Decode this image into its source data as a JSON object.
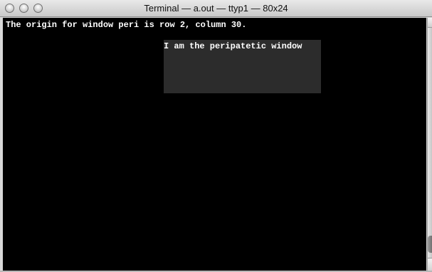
{
  "window": {
    "title": "Terminal — a.out — ttyp1 — 80x24"
  },
  "terminal": {
    "lines": [
      "The origin for window peri is row 2, column 30."
    ],
    "subwindow": {
      "text": "I am the peripatetic window",
      "background": "#2c2c2c"
    },
    "background": "#000000",
    "foreground": "#ffffff"
  }
}
